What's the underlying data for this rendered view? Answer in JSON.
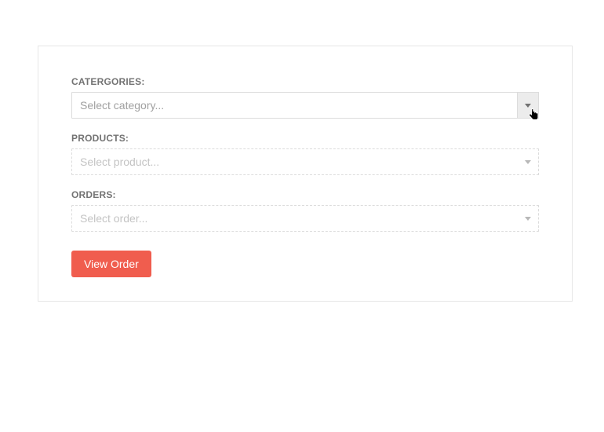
{
  "fields": {
    "categories": {
      "label": "CATERGORIES:",
      "placeholder": "Select category..."
    },
    "products": {
      "label": "PRODUCTS:",
      "placeholder": "Select product..."
    },
    "orders": {
      "label": "ORDERS:",
      "placeholder": "Select order..."
    }
  },
  "button": {
    "view_order": "View Order"
  }
}
